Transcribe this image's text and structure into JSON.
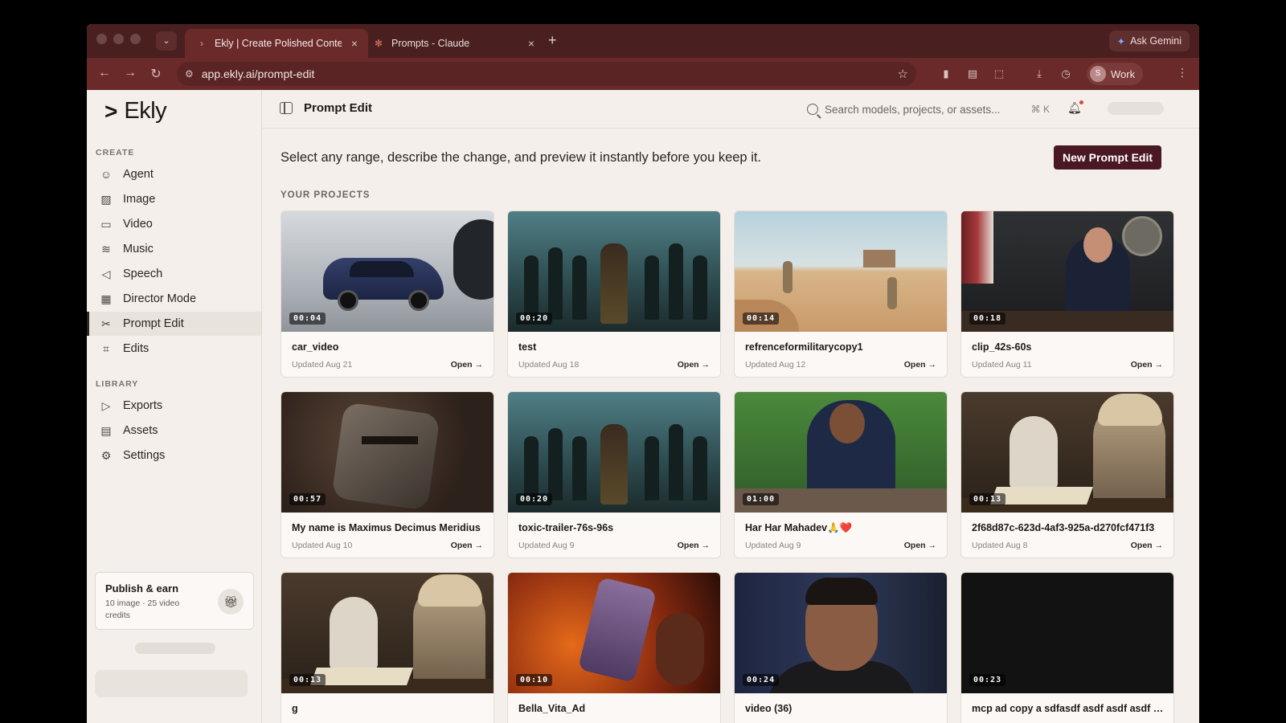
{
  "browser": {
    "tabs": [
      {
        "title": "Ekly | Create Polished Content",
        "active": true
      },
      {
        "title": "Prompts - Claude",
        "active": false
      }
    ],
    "ask_label": "Ask Gemini",
    "url": "app.ekly.ai/prompt-edit",
    "profile_initial": "S",
    "profile_label": "Work"
  },
  "brand": {
    "name": "Ekly"
  },
  "sidebar": {
    "create_label": "CREATE",
    "create_items": [
      {
        "label": "Agent",
        "icon": "robot-icon"
      },
      {
        "label": "Image",
        "icon": "image-icon"
      },
      {
        "label": "Video",
        "icon": "video-icon"
      },
      {
        "label": "Music",
        "icon": "waveform-icon"
      },
      {
        "label": "Speech",
        "icon": "speaker-icon"
      },
      {
        "label": "Director Mode",
        "icon": "clapper-icon"
      },
      {
        "label": "Prompt Edit",
        "icon": "scissors-icon",
        "active": true
      },
      {
        "label": "Edits",
        "icon": "crop-icon"
      }
    ],
    "library_label": "LIBRARY",
    "library_items": [
      {
        "label": "Exports",
        "icon": "play-icon"
      },
      {
        "label": "Assets",
        "icon": "archive-icon"
      },
      {
        "label": "Settings",
        "icon": "gear-icon"
      }
    ],
    "publish": {
      "title": "Publish & earn",
      "subtitle": "10 image · 25 video credits"
    }
  },
  "header": {
    "title": "Prompt Edit",
    "search_placeholder": "Search models, projects, or assets...",
    "search_shortcut": "⌘ K"
  },
  "main": {
    "description": "Select any range, describe the change, and preview it instantly before you keep it.",
    "new_button": "New Prompt Edit",
    "projects_label": "YOUR PROJECTS",
    "open_label": "Open →",
    "projects": [
      {
        "name": "car_video",
        "duration": "00:04",
        "updated": "Updated Aug 21",
        "thumb": "t-car"
      },
      {
        "name": "test",
        "duration": "00:20",
        "updated": "Updated Aug 18",
        "thumb": "t-army"
      },
      {
        "name": "refrenceformilitarycopy1",
        "duration": "00:14",
        "updated": "Updated Aug 12",
        "thumb": "t-desert"
      },
      {
        "name": "clip_42s-60s",
        "duration": "00:18",
        "updated": "Updated Aug 11",
        "thumb": "t-court"
      },
      {
        "name": "My name is Maximus Decimus Meridius",
        "duration": "00:57",
        "updated": "Updated Aug 10",
        "thumb": "t-helm"
      },
      {
        "name": "toxic-trailer-76s-96s",
        "duration": "00:20",
        "updated": "Updated Aug 9",
        "thumb": "t-army"
      },
      {
        "name": "Har Har Mahadev🙏❤️",
        "duration": "01:00",
        "updated": "Updated Aug 9",
        "thumb": "t-green"
      },
      {
        "name": "2f68d87c-623d-4af3-925a-d270fcf471f3",
        "duration": "00:13",
        "updated": "Updated Aug 8",
        "thumb": "t-library"
      },
      {
        "name": "g",
        "duration": "00:13",
        "updated": "",
        "thumb": "t-library"
      },
      {
        "name": "Bella_Vita_Ad",
        "duration": "00:10",
        "updated": "",
        "thumb": "t-fire"
      },
      {
        "name": "video (36)",
        "duration": "00:24",
        "updated": "",
        "thumb": "t-talk"
      },
      {
        "name": "mcp ad copy a sdfasdf asdf asdf asdf a...",
        "duration": "00:23",
        "updated": "",
        "thumb": "t-black"
      }
    ]
  }
}
